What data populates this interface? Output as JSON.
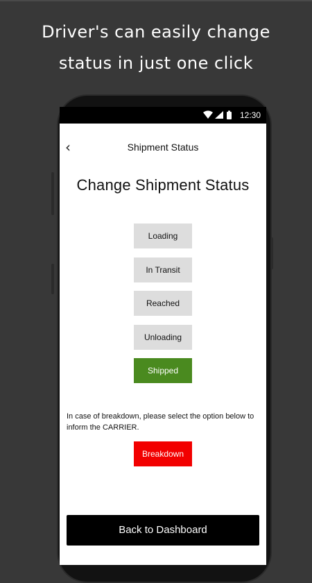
{
  "promo": {
    "headline_line1": "Driver's can easily change",
    "headline_line2": "status in just one click"
  },
  "status_bar": {
    "time": "12:30",
    "icons": [
      "wifi-icon",
      "signal-icon",
      "battery-icon"
    ]
  },
  "app_bar": {
    "back_icon": "chevron-left-icon",
    "title": "Shipment Status"
  },
  "main": {
    "title": "Change Shipment Status",
    "status_options": [
      {
        "label": "Loading",
        "selected": false
      },
      {
        "label": "In Transit",
        "selected": false
      },
      {
        "label": "Reached",
        "selected": false
      },
      {
        "label": "Unloading",
        "selected": false
      },
      {
        "label": "Shipped",
        "selected": true
      }
    ],
    "breakdown_note": "In case of breakdown, please select the option below to inform the CARRIER.",
    "breakdown_label": "Breakdown",
    "dashboard_label": "Back to Dashboard"
  },
  "colors": {
    "selected_status": "#4a8a1f",
    "breakdown": "#f20000",
    "status_default": "#dddddd",
    "primary_button": "#000000",
    "background": "#383838"
  }
}
